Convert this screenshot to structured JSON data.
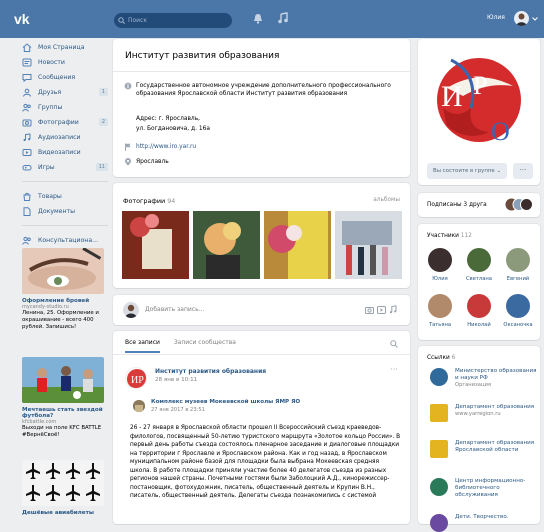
{
  "header": {
    "search_placeholder": "Поиск",
    "user_name": "Юлия"
  },
  "nav": {
    "items": [
      {
        "label": "Моя Страница"
      },
      {
        "label": "Новости"
      },
      {
        "label": "Сообщения"
      },
      {
        "label": "Друзья",
        "count": "1"
      },
      {
        "label": "Группы"
      },
      {
        "label": "Фотографии",
        "count": "2"
      },
      {
        "label": "Аудиозаписи"
      },
      {
        "label": "Видеозаписи"
      },
      {
        "label": "Игры",
        "count": "11"
      }
    ],
    "items2": [
      {
        "label": "Товары"
      },
      {
        "label": "Документы"
      }
    ],
    "items3": [
      {
        "label": "Консультациона..."
      }
    ]
  },
  "ads": [
    {
      "title": "Оформление бровей",
      "source": "mycandy-studio.ru",
      "text": "Ленина, 25. Оформление и окрашивание - всего 400 рублей. Запишись!"
    },
    {
      "title": "Мечтаешь стать звездой футбола?",
      "source": "kfcbattle.com",
      "text": "Выходи на поле KFC BATTLE #ВернёСвоё!"
    },
    {
      "title": "Дешёвые авиабилеты"
    }
  ],
  "group": {
    "name": "Институт развития образования",
    "description": "Государственное автономное учреждение дополнительного профессионального образования Ярославской области Институт развития образования",
    "address_line1": "Адрес: г. Ярославль,",
    "address_line2": "ул. Богдановича, д. 16а",
    "site": "http://www.iro.yar.ru",
    "city": "Ярославль"
  },
  "photos": {
    "label": "Фотографии",
    "count": "94",
    "albums": "альбомы"
  },
  "composer": {
    "placeholder": "Добавить запись..."
  },
  "wall": {
    "tab1": "Все записи",
    "tab2": "Записи сообщества"
  },
  "post": {
    "author": "Институт развития образования",
    "date": "28 янв в 10:11",
    "repost_author": "Комплекс музеев Мокеевской школы ЯМР ЯО",
    "repost_date": "27 янв 2017 в 23:51",
    "text": "26 - 27 января в Ярославской области прошел II Всероссийский съезд краеведов-филологов, посвященный 50-летию туристского маршрута «Золотое кольцо России». В первый день работы съезда состоялось пленарное заседание и диалоговые площадки на территории г Ярославле и Ярославском района. Как и год назад, в Ярославском муниципальном районе базой для площадки была выбрана Мокеевская средняя школа. В работе площадки приняли участие более 40 делегатов съезда из разных регионов нашей страны. Почетными гостями были Заболоцкий А.Д., кинорежиссер-постановщик, фотохудожник, писатель, общественный деятель и Крупин В.Н., писатель, общественный деятель. Делегаты съезда познакомились с системой"
  },
  "logo": {
    "letters": [
      "И",
      "Р",
      "О"
    ]
  },
  "membership": {
    "button": "Вы состоите в группе",
    "more": "···"
  },
  "friends_sub": {
    "text": "Подписаны 3 друга"
  },
  "members": {
    "label": "Участники",
    "count": "112",
    "people": [
      {
        "name": "Юлия"
      },
      {
        "name": "Светлана"
      },
      {
        "name": "Евгений"
      },
      {
        "name": "Татьяна"
      },
      {
        "name": "Николай"
      },
      {
        "name": "Оксаночка"
      }
    ]
  },
  "links": {
    "label": "Ссылки",
    "count": "6",
    "items": [
      {
        "title": "Министерство образования и науки РФ",
        "sub": "Организация"
      },
      {
        "title": "Департамент образования",
        "sub": "www.yarregion.ru"
      },
      {
        "title": "Департамент образования Ярославской области",
        "sub": ""
      },
      {
        "title": "Центр информационно-библиотечного обслуживания",
        "sub": ""
      },
      {
        "title": "Дети. Творчество.",
        "sub": ""
      }
    ]
  }
}
